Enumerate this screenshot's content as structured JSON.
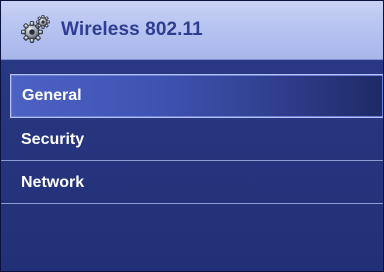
{
  "window": {
    "title": "Wireless 802.11",
    "icon": "gears-icon"
  },
  "colors": {
    "title_bar": "#b7c3f1",
    "title_text": "#2e3f93",
    "background": "#27367f",
    "selected_item": "#3f52b1",
    "divider": "#8d99cf"
  },
  "menu": {
    "items": [
      {
        "label": "General",
        "selected": true
      },
      {
        "label": "Security",
        "selected": false
      },
      {
        "label": "Network",
        "selected": false
      }
    ]
  }
}
